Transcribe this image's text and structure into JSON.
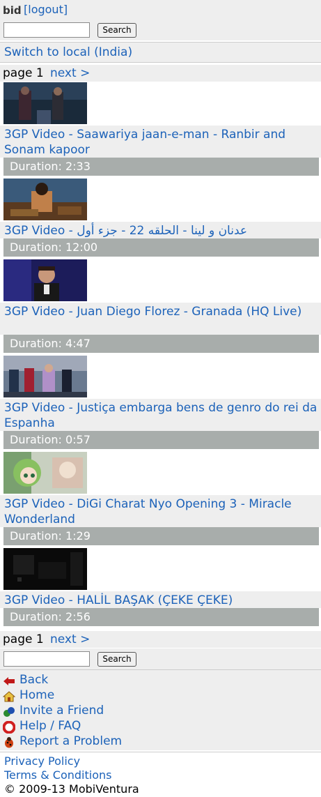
{
  "header": {
    "logo_text": "bid",
    "logout_label": "[logout]"
  },
  "search": {
    "button_label": "Search",
    "value": "",
    "placeholder": ""
  },
  "switch_label": "Switch to local (India)",
  "pager": {
    "page_text": "page 1",
    "next_label": "next >"
  },
  "videos": [
    {
      "title": "3GP Video - Saawariya jaan-e-man - Ranbir and Sonam kapoor",
      "duration": "Duration: 2:33"
    },
    {
      "title": "3GP Video - عدنان و لينا - الحلقه 22 - جزء أول",
      "duration": "Duration: 12:00"
    },
    {
      "title": "3GP Video - Juan Diego Florez - Granada (HQ Live)",
      "duration": "Duration: 4:47"
    },
    {
      "title": "3GP Video - Justiça embarga bens de genro do rei da Espanha",
      "duration": "Duration: 0:57"
    },
    {
      "title": "3GP Video - DiGi Charat Nyo Opening 3 - Miracle Wonderland",
      "duration": "Duration: 1:29"
    },
    {
      "title": "3GP Video - HALİL BAŞAK (ÇEKE ÇEKE)",
      "duration": "Duration: 2:56"
    }
  ],
  "nav": [
    {
      "label": "Back",
      "icon": "back-arrow-icon"
    },
    {
      "label": "Home",
      "icon": "home-icon"
    },
    {
      "label": "Invite a Friend",
      "icon": "invite-friend-icon"
    },
    {
      "label": "Help / FAQ",
      "icon": "help-icon"
    },
    {
      "label": "Report a Problem",
      "icon": "bug-icon"
    }
  ],
  "footer": {
    "privacy": "Privacy Policy",
    "terms": "Terms & Conditions",
    "copyright": "© 2009-13 MobiVentura"
  },
  "colors": {
    "link": "#1c62b9",
    "bar_bg": "#eeeeee",
    "duration_bg": "#a8adab"
  }
}
